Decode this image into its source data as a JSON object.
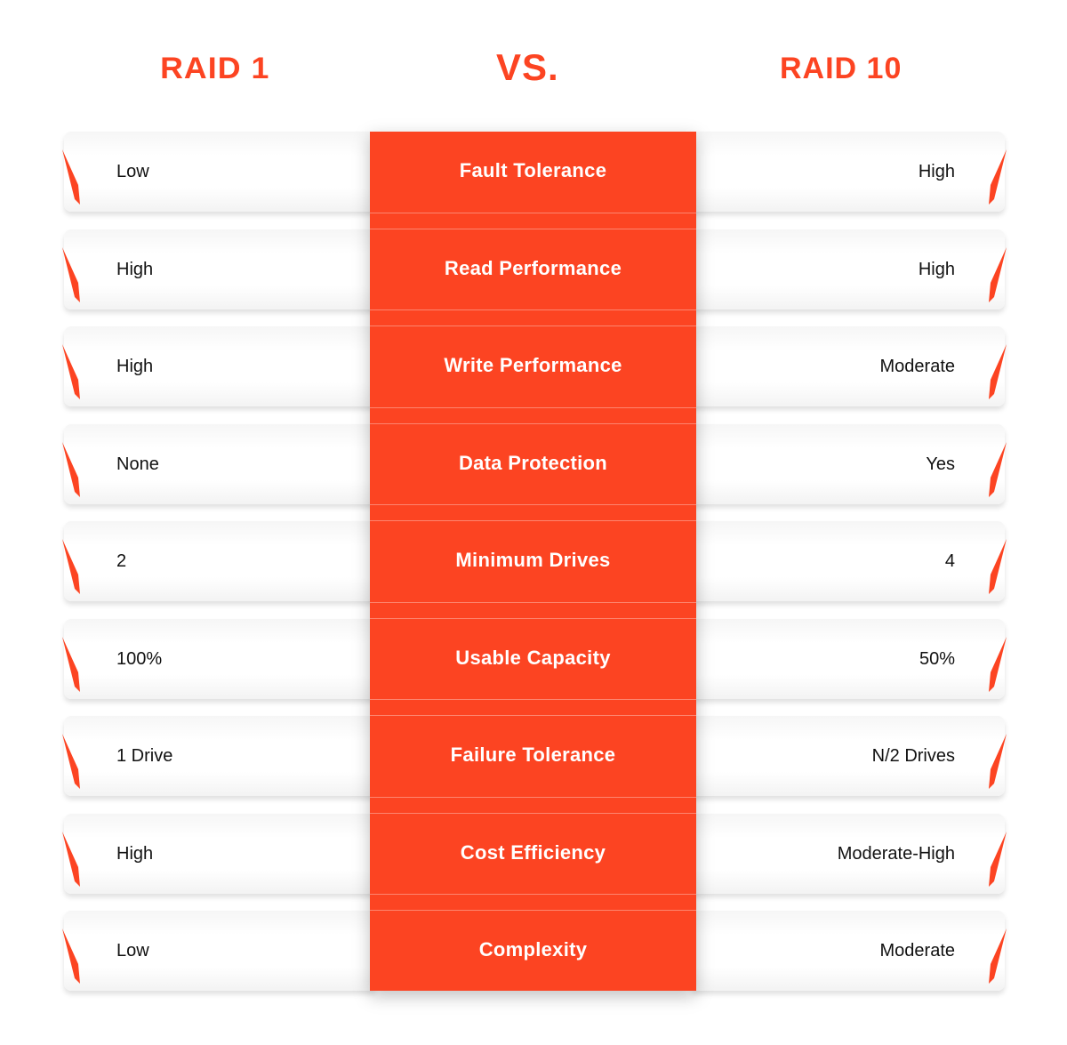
{
  "header": {
    "left_title": "RAID 1",
    "vs": "VS.",
    "right_title": "RAID 10"
  },
  "colors": {
    "accent": "#fc4422",
    "text": "#111111",
    "label_text": "#ffffff"
  },
  "rows": [
    {
      "criterion": "Fault Tolerance",
      "raid1": "Low",
      "raid10": "High"
    },
    {
      "criterion": "Read Performance",
      "raid1": "High",
      "raid10": "High"
    },
    {
      "criterion": "Write Performance",
      "raid1": "High",
      "raid10": "Moderate"
    },
    {
      "criterion": "Data Protection",
      "raid1": "None",
      "raid10": "Yes"
    },
    {
      "criterion": "Minimum Drives",
      "raid1": "2",
      "raid10": "4"
    },
    {
      "criterion": "Usable Capacity",
      "raid1": "100%",
      "raid10": "50%"
    },
    {
      "criterion": "Failure Tolerance",
      "raid1": "1 Drive",
      "raid10": "N/2 Drives"
    },
    {
      "criterion": "Cost Efficiency",
      "raid1": "High",
      "raid10": "Moderate-High"
    },
    {
      "criterion": "Complexity",
      "raid1": "Low",
      "raid10": "Moderate"
    }
  ]
}
